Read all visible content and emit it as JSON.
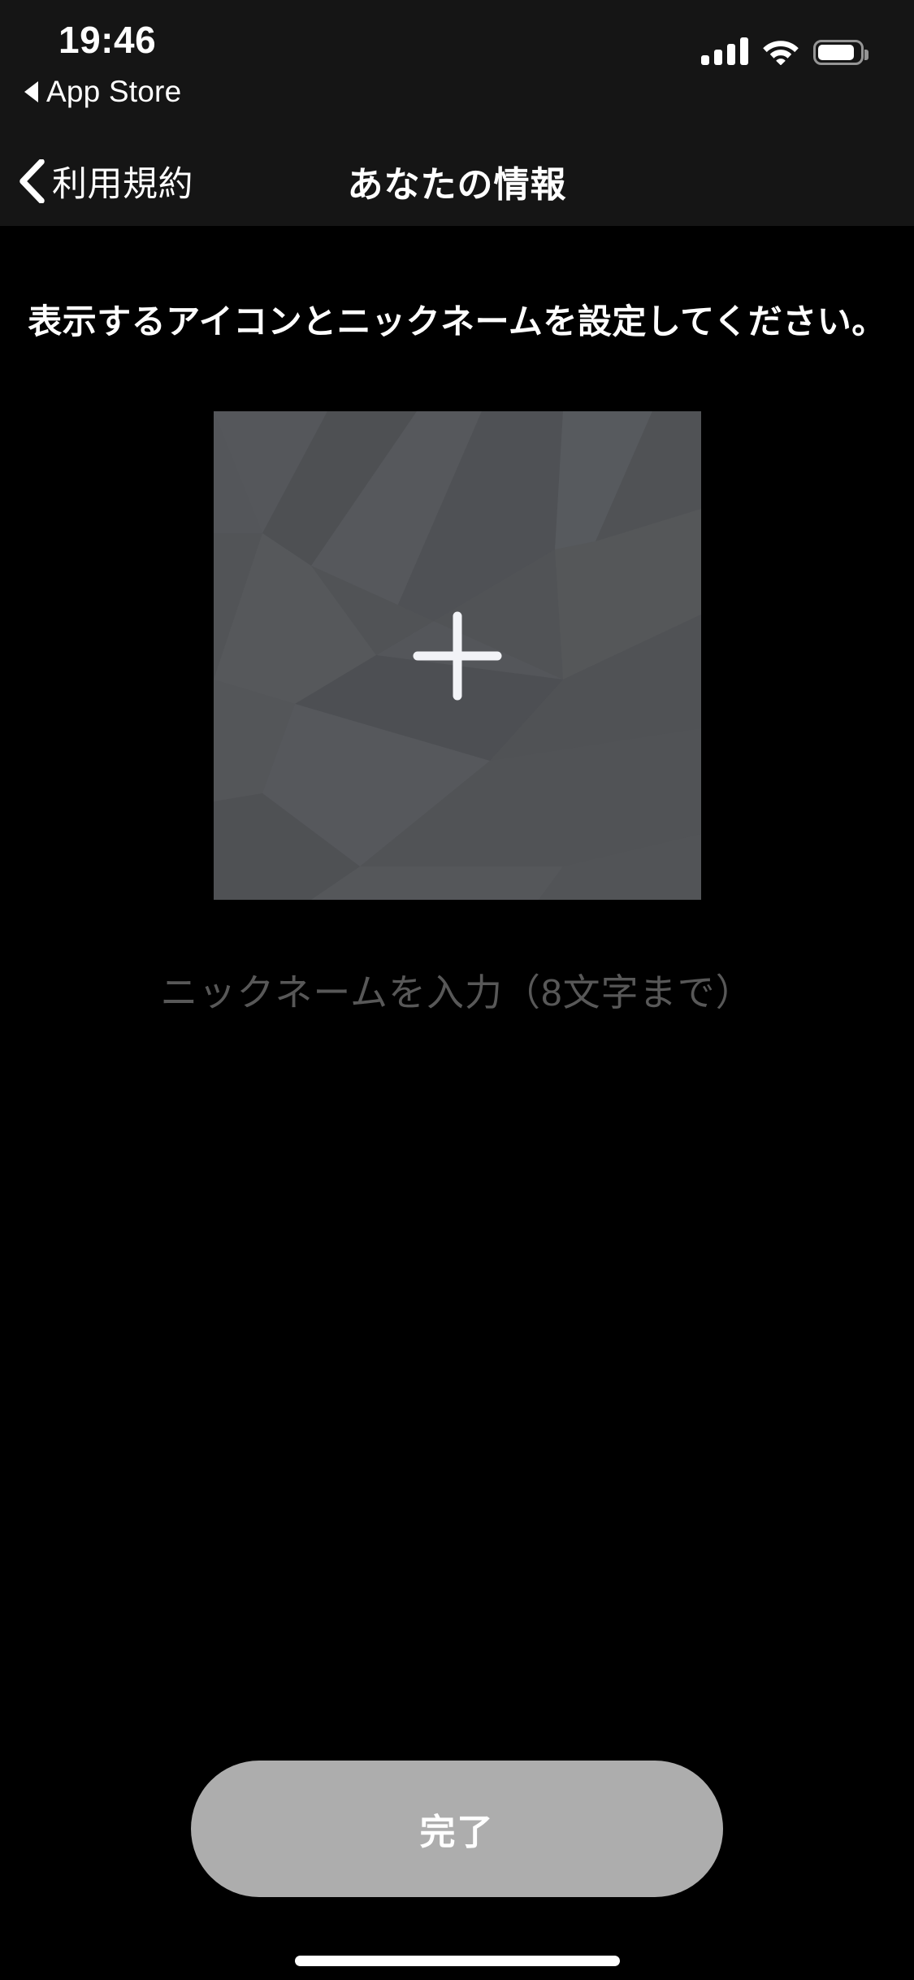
{
  "status_bar": {
    "time": "19:46",
    "return_app_label": "App Store",
    "return_icon": "triangle-left-icon",
    "cellular_icon": "cellular-signal-icon",
    "cellular_bars": 4,
    "wifi_icon": "wifi-icon",
    "battery_icon": "battery-icon",
    "battery_level_percent": 88
  },
  "nav_bar": {
    "back_icon": "chevron-left-icon",
    "back_label": "利用規約",
    "title": "あなたの情報",
    "background_color": "#151515"
  },
  "main": {
    "headline": "表示するアイコンとニックネームを設定してください。",
    "avatar_picker": {
      "name": "avatar-upload-placeholder",
      "add_icon": "plus-icon",
      "background_color": "#54565A"
    },
    "nickname_input": {
      "placeholder": "ニックネームを入力（8文字まで）",
      "value": "",
      "placeholder_color": "#585858"
    }
  },
  "footer": {
    "done_label": "完了",
    "done_button_color": "#ADADAD",
    "done_text_color": "#FFFFFF"
  },
  "system": {
    "home_indicator": "home-indicator"
  },
  "theme": {
    "page_background": "#000000",
    "bar_background": "#151515",
    "text_primary": "#FFFFFF"
  }
}
